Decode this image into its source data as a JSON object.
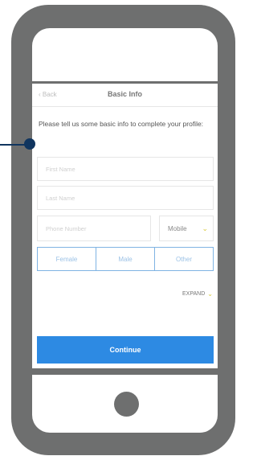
{
  "nav": {
    "back_label": "‹ Back",
    "title": "Basic Info"
  },
  "form": {
    "instructions": "Please tell us some basic info to complete your profile:",
    "first_name_placeholder": "First Name",
    "last_name_placeholder": "Last Name",
    "phone_placeholder": "Phone Number",
    "phone_type": "Mobile",
    "gender_options": [
      "Female",
      "Male",
      "Other"
    ],
    "expand_label": "EXPAND",
    "continue_label": "Continue"
  },
  "colors": {
    "primary": "#2d8ae3",
    "frame": "#6e6f6f",
    "callout": "#10355f",
    "accent": "#d8c93a"
  },
  "icons": {
    "home_button": "circle",
    "chevron": "chevron-down-icon",
    "callout": "callout-dot"
  }
}
